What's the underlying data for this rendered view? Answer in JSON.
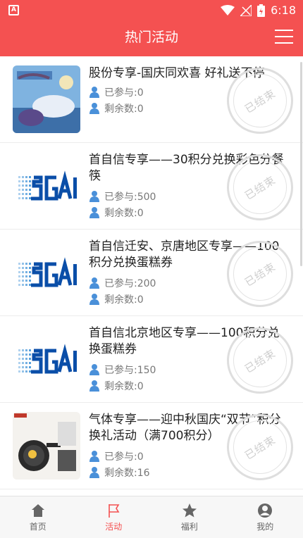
{
  "status_bar": {
    "time": "6:18",
    "app_icon_letter": "A"
  },
  "header": {
    "title": "热门活动",
    "menu_icon": "menu-icon"
  },
  "activities": [
    {
      "title": "股份专享-国庆同欢喜 好礼送不停",
      "participated": "已参与:0",
      "remaining": "剩余数:0",
      "stamp": "已结束",
      "thumb": "festival"
    },
    {
      "title": "首自信专享——30积分兑换彩色分餐筷",
      "participated": "已参与:500",
      "remaining": "剩余数:0",
      "stamp": "已结束",
      "thumb": "logo"
    },
    {
      "title": "首自信迁安、京唐地区专享——100积分兑换蛋糕券",
      "participated": "已参与:200",
      "remaining": "剩余数:0",
      "stamp": "已结束",
      "thumb": "logo"
    },
    {
      "title": "首自信北京地区专享——100积分兑换蛋糕券",
      "participated": "已参与:150",
      "remaining": "剩余数:0",
      "stamp": "已结束",
      "thumb": "logo"
    },
    {
      "title": "气体专享——迎中秋国庆“双节”积分换礼活动（满700积分）",
      "participated": "已参与:0",
      "remaining": "剩余数:16",
      "stamp": "已结束",
      "thumb": "cookware"
    }
  ],
  "tabs": [
    {
      "label": "首页",
      "icon": "home-icon",
      "active": false
    },
    {
      "label": "活动",
      "icon": "flag-icon",
      "active": true
    },
    {
      "label": "福利",
      "icon": "star-icon",
      "active": false
    },
    {
      "label": "我的",
      "icon": "profile-icon",
      "active": false
    }
  ],
  "colors": {
    "brand": "#f45151",
    "icon_blue": "#4a90d9",
    "stamp_gray": "#cfcfcf"
  }
}
